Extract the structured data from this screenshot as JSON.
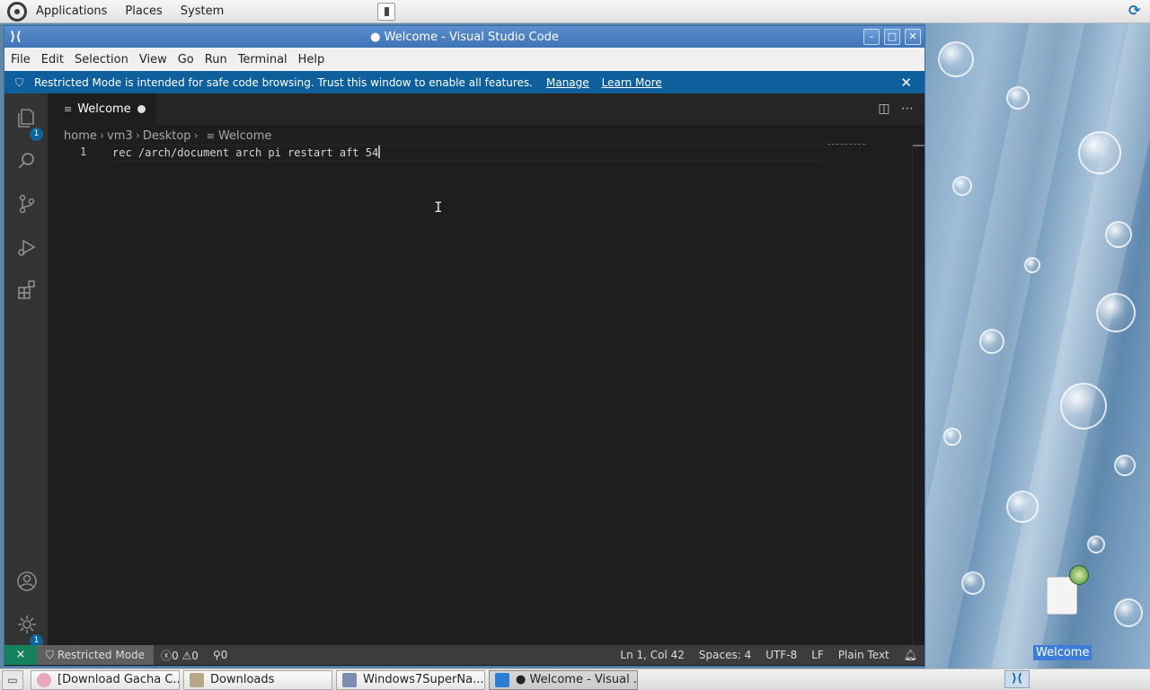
{
  "top_panel": {
    "menus": [
      "Applications",
      "Places",
      "System"
    ]
  },
  "window": {
    "title": "● Welcome - Visual Studio Code",
    "buttons": {
      "minimize": "–",
      "maximize": "□",
      "close": "✕"
    }
  },
  "menu_bar": {
    "items": [
      "File",
      "Edit",
      "Selection",
      "View",
      "Go",
      "Run",
      "Terminal",
      "Help"
    ]
  },
  "banner": {
    "text": "Restricted Mode is intended for safe code browsing. Trust this window to enable all features.",
    "manage": "Manage",
    "learn_more": "Learn More",
    "close": "✕"
  },
  "activity_bar": {
    "explorer_badge": "1",
    "settings_badge": "1"
  },
  "tabs": [
    {
      "label": "Welcome",
      "dirty": true
    }
  ],
  "breadcrumb": [
    "home",
    "vm3",
    "Desktop",
    "Welcome"
  ],
  "editor": {
    "line_number": "1",
    "line_text": "rec /arch/document arch pi restart aft 54"
  },
  "status_bar": {
    "remote": "⨯",
    "restricted": "Restricted Mode",
    "errors": "0",
    "warnings": "0",
    "ports": "0",
    "position": "Ln 1, Col 42",
    "spaces": "Spaces: 4",
    "encoding": "UTF-8",
    "eol": "LF",
    "language": "Plain Text"
  },
  "desktop_icon": {
    "label": "Welcome"
  },
  "taskbar": {
    "items": [
      {
        "label": "[Download Gacha C...",
        "icon_color": "#e6a8c0"
      },
      {
        "label": "Downloads",
        "icon_color": "#b8a888"
      },
      {
        "label": "Windows7SuperNa...",
        "icon_color": "#7a8fb0"
      },
      {
        "label": "● Welcome - Visual ...",
        "icon_color": "#2a7fd4"
      }
    ]
  },
  "colors": {
    "accent": "#0e5f9b",
    "status_remote": "#16825d",
    "badge": "#0e639c"
  }
}
